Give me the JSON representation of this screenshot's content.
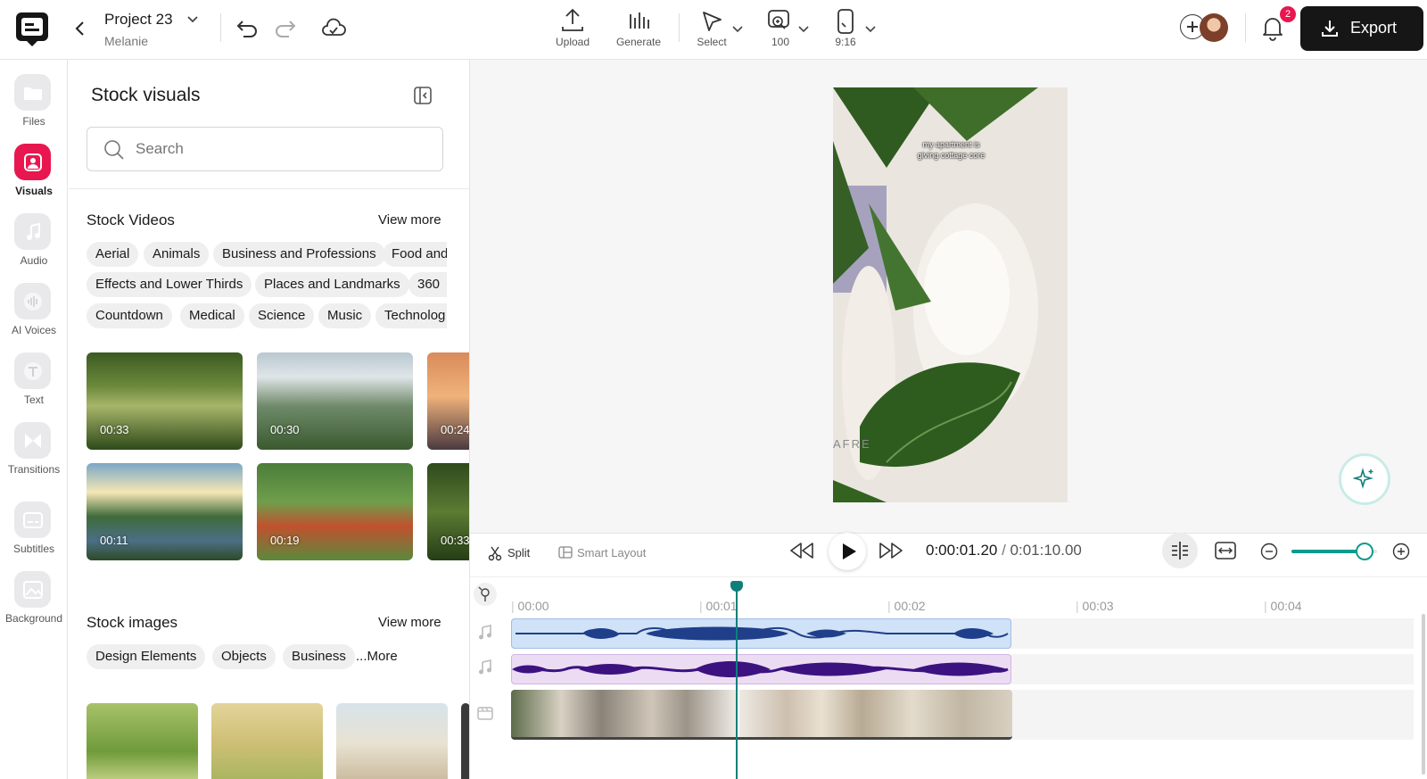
{
  "project": {
    "title": "Project 23",
    "owner": "Melanie"
  },
  "toolbar": {
    "upload": "Upload",
    "generate": "Generate",
    "select": "Select",
    "zoom": "100",
    "ratio": "9:16",
    "export": "Export",
    "notifications_count": "2"
  },
  "rail": [
    {
      "label": "Files",
      "icon": "folder-icon"
    },
    {
      "label": "Visuals",
      "icon": "image-icon",
      "active": true
    },
    {
      "label": "Audio",
      "icon": "music-note-icon"
    },
    {
      "label": "AI Voices",
      "icon": "voice-wave-icon"
    },
    {
      "label": "Text",
      "icon": "text-icon"
    },
    {
      "label": "Transitions",
      "icon": "transition-icon"
    },
    {
      "label": "Subtitles",
      "icon": "subtitles-icon"
    },
    {
      "label": "Background",
      "icon": "background-icon"
    }
  ],
  "panel": {
    "title": "Stock visuals",
    "search_placeholder": "Search",
    "videos": {
      "heading": "Stock Videos",
      "view_more": "View more",
      "chips_row1": [
        "Aerial",
        "Animals",
        "Business and Professions",
        "Food and"
      ],
      "chips_row2": [
        "Effects and Lower Thirds",
        "Places and Landmarks",
        "360"
      ],
      "chips_row3": [
        "Countdown",
        "Medical",
        "Science",
        "Music",
        "Technolog"
      ],
      "durations": [
        "00:33",
        "00:30",
        "00:24",
        "00:11",
        "00:19",
        "00:33"
      ]
    },
    "images": {
      "heading": "Stock images",
      "view_more": "View more",
      "chips": [
        "Design Elements",
        "Objects",
        "Business",
        "...More"
      ]
    }
  },
  "preview": {
    "caption": "my apartment is\ngiving cottage core",
    "watermark": "AFRE"
  },
  "timeline": {
    "split": "Split",
    "smart_layout": "Smart Layout",
    "time_current": "0:00:01.20",
    "time_separator": " / ",
    "time_total": "0:01:10.00",
    "zoom_level": 0.85,
    "ticks": [
      "00:00",
      "00:01",
      "00:02",
      "00:03",
      "00:04"
    ]
  },
  "colors": {
    "accent": "#e8174f",
    "dark": "#161616",
    "playhead": "#0f7f7a",
    "audio1": "#cfe2f7",
    "audio1_wave": "#1f3f8a",
    "audio2": "#ecdcf3",
    "audio2_wave": "#3c1280"
  }
}
